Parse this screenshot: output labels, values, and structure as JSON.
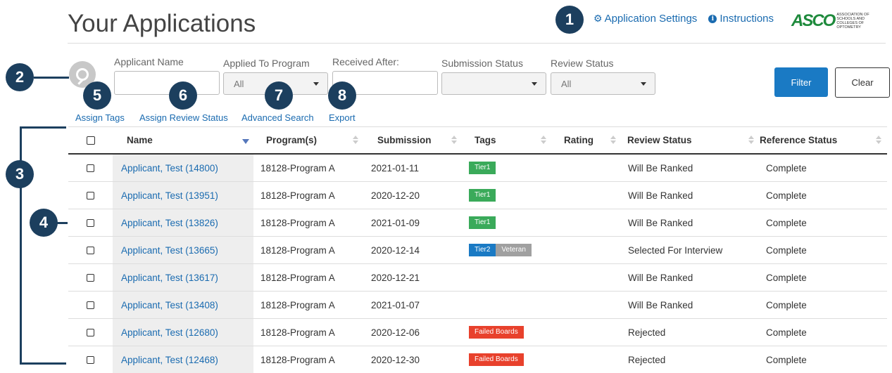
{
  "header": {
    "title": "Your Applications",
    "settings_label": "Application Settings",
    "instructions_label": "Instructions",
    "logo_mark": "ASCO",
    "logo_text": "Association of Schools and Colleges of Optometry"
  },
  "markers": [
    "1",
    "2",
    "3",
    "4",
    "5",
    "6",
    "7",
    "8"
  ],
  "filters": {
    "applicant_name_label": "Applicant Name",
    "applicant_name_value": "",
    "program_label": "Applied To Program",
    "program_value": "All",
    "received_label": "Received After:",
    "received_value": "",
    "submission_label": "Submission Status",
    "submission_value": "",
    "review_label": "Review Status",
    "review_value": "All",
    "filter_button": "Filter",
    "clear_button": "Clear"
  },
  "actions": {
    "assign_tags": "Assign Tags",
    "assign_review": "Assign Review Status",
    "advanced_search": "Advanced Search",
    "export": "Export"
  },
  "table": {
    "columns": [
      "Name",
      "Program(s)",
      "Submission",
      "Tags",
      "Rating",
      "Review Status",
      "Reference Status"
    ],
    "rows": [
      {
        "name": "Applicant, Test (14800)",
        "program": "18128-Program A",
        "submission": "2021-01-11",
        "tags": [
          {
            "label": "Tier1",
            "color": "#3aaa5a"
          }
        ],
        "rating": "",
        "review": "Will Be Ranked",
        "reference": "Complete"
      },
      {
        "name": "Applicant, Test (13951)",
        "program": "18128-Program A",
        "submission": "2020-12-20",
        "tags": [
          {
            "label": "Tier1",
            "color": "#3aaa5a"
          }
        ],
        "rating": "",
        "review": "Will Be Ranked",
        "reference": "Complete"
      },
      {
        "name": "Applicant, Test (13826)",
        "program": "18128-Program A",
        "submission": "2021-01-09",
        "tags": [
          {
            "label": "Tier1",
            "color": "#3aaa5a"
          }
        ],
        "rating": "",
        "review": "Will Be Ranked",
        "reference": "Complete"
      },
      {
        "name": "Applicant, Test (13665)",
        "program": "18128-Program A",
        "submission": "2020-12-14",
        "tags": [
          {
            "label": "Tier2",
            "color": "#1a7ac4"
          },
          {
            "label": "Veteran",
            "color": "#a0a0a0"
          }
        ],
        "rating": "",
        "review": "Selected For Interview",
        "reference": "Complete"
      },
      {
        "name": "Applicant, Test (13617)",
        "program": "18128-Program A",
        "submission": "2020-12-21",
        "tags": [],
        "rating": "",
        "review": "Will Be Ranked",
        "reference": "Complete"
      },
      {
        "name": "Applicant, Test (13408)",
        "program": "18128-Program A",
        "submission": "2021-01-07",
        "tags": [],
        "rating": "",
        "review": "Will Be Ranked",
        "reference": "Complete"
      },
      {
        "name": "Applicant, Test (12680)",
        "program": "18128-Program A",
        "submission": "2020-12-06",
        "tags": [
          {
            "label": "Failed Boards",
            "color": "#e8412c"
          }
        ],
        "rating": "",
        "review": "Rejected",
        "reference": "Complete"
      },
      {
        "name": "Applicant, Test (12468)",
        "program": "18128-Program A",
        "submission": "2020-12-30",
        "tags": [
          {
            "label": "Failed Boards",
            "color": "#e8412c"
          }
        ],
        "rating": "",
        "review": "Rejected",
        "reference": "Complete"
      }
    ]
  }
}
